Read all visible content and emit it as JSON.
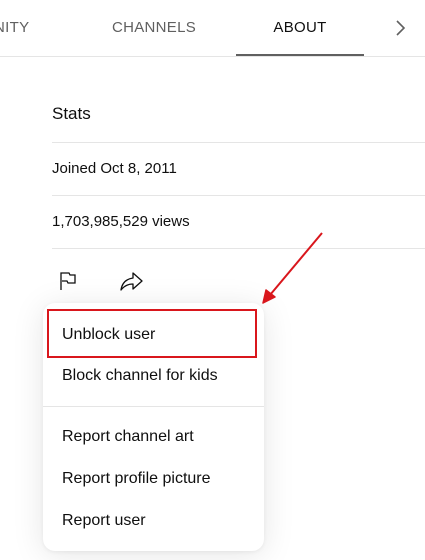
{
  "tabs": {
    "community_label": "NITY",
    "channels_label": "CHANNELS",
    "about_label": "ABOUT",
    "active": "ABOUT",
    "next_icon": "chevron-right-icon"
  },
  "stats": {
    "title": "Stats",
    "joined": "Joined Oct 8, 2011",
    "views": "1,703,985,529 views"
  },
  "actions": {
    "flag_icon": "flag-icon",
    "share_icon": "share-icon"
  },
  "menu": {
    "unblock_user": "Unblock user",
    "block_channel_for_kids": "Block channel for kids",
    "report_channel_art": "Report channel art",
    "report_profile_picture": "Report profile picture",
    "report_user": "Report user"
  },
  "annotation": {
    "highlight_color": "#d9161c",
    "target": "Unblock user"
  }
}
